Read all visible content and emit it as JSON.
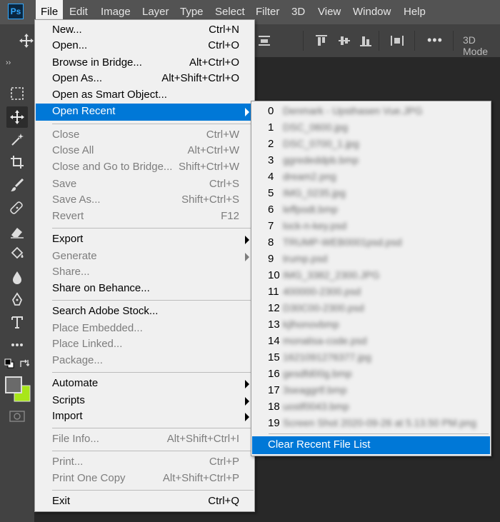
{
  "app": {
    "logo": "Ps"
  },
  "menubar": {
    "items": [
      "File",
      "Edit",
      "Image",
      "Layer",
      "Type",
      "Select",
      "Filter",
      "3D",
      "View",
      "Window",
      "Help"
    ],
    "active": "File"
  },
  "options_bar": {
    "more": "•••",
    "mode_label": "3D Mode"
  },
  "toolbar": {
    "expand": "››"
  },
  "file_menu": {
    "items": [
      {
        "label": "New...",
        "shortcut": "Ctrl+N",
        "enabled": true
      },
      {
        "label": "Open...",
        "shortcut": "Ctrl+O",
        "enabled": true
      },
      {
        "label": "Browse in Bridge...",
        "shortcut": "Alt+Ctrl+O",
        "enabled": true
      },
      {
        "label": "Open As...",
        "shortcut": "Alt+Shift+Ctrl+O",
        "enabled": true
      },
      {
        "label": "Open as Smart Object...",
        "shortcut": "",
        "enabled": true
      },
      {
        "label": "Open Recent",
        "shortcut": "",
        "enabled": true,
        "submenu": true,
        "highlighted": true
      },
      {
        "label": "Close",
        "shortcut": "Ctrl+W",
        "enabled": false
      },
      {
        "label": "Close All",
        "shortcut": "Alt+Ctrl+W",
        "enabled": false
      },
      {
        "label": "Close and Go to Bridge...",
        "shortcut": "Shift+Ctrl+W",
        "enabled": false
      },
      {
        "label": "Save",
        "shortcut": "Ctrl+S",
        "enabled": false
      },
      {
        "label": "Save As...",
        "shortcut": "Shift+Ctrl+S",
        "enabled": false
      },
      {
        "label": "Revert",
        "shortcut": "F12",
        "enabled": false
      },
      {
        "label": "Export",
        "shortcut": "",
        "enabled": true,
        "submenu": true
      },
      {
        "label": "Generate",
        "shortcut": "",
        "enabled": false,
        "submenu": true
      },
      {
        "label": "Share...",
        "shortcut": "",
        "enabled": false
      },
      {
        "label": "Share on Behance...",
        "shortcut": "",
        "enabled": true
      },
      {
        "label": "Search Adobe Stock...",
        "shortcut": "",
        "enabled": true
      },
      {
        "label": "Place Embedded...",
        "shortcut": "",
        "enabled": false
      },
      {
        "label": "Place Linked...",
        "shortcut": "",
        "enabled": false
      },
      {
        "label": "Package...",
        "shortcut": "",
        "enabled": false
      },
      {
        "label": "Automate",
        "shortcut": "",
        "enabled": true,
        "submenu": true
      },
      {
        "label": "Scripts",
        "shortcut": "",
        "enabled": true,
        "submenu": true
      },
      {
        "label": "Import",
        "shortcut": "",
        "enabled": true,
        "submenu": true
      },
      {
        "label": "File Info...",
        "shortcut": "Alt+Shift+Ctrl+I",
        "enabled": false
      },
      {
        "label": "Print...",
        "shortcut": "Ctrl+P",
        "enabled": false
      },
      {
        "label": "Print One Copy",
        "shortcut": "Alt+Shift+Ctrl+P",
        "enabled": false
      },
      {
        "label": "Exit",
        "shortcut": "Ctrl+Q",
        "enabled": true
      }
    ]
  },
  "open_recent": {
    "files": [
      {
        "num": "0",
        "name": "Denmark - Upsthasen Vue.JPG"
      },
      {
        "num": "1",
        "name": "DSC_0600.jpg"
      },
      {
        "num": "2",
        "name": "DSC_0700_1.jpg"
      },
      {
        "num": "3",
        "name": "ggrededdpb.bmp"
      },
      {
        "num": "4",
        "name": "dream2.png"
      },
      {
        "num": "5",
        "name": "IMG_0235.jpg"
      },
      {
        "num": "6",
        "name": "leffpodt.bmp"
      },
      {
        "num": "7",
        "name": "lock-n-key.psd"
      },
      {
        "num": "8",
        "name": "TRUMP-WEB0001psd.psd"
      },
      {
        "num": "9",
        "name": "trump.psd"
      },
      {
        "num": "10",
        "name": "IMG_3382_2300.JPG"
      },
      {
        "num": "11",
        "name": "400000-2300.psd"
      },
      {
        "num": "12",
        "name": "D30C00-2300.psd"
      },
      {
        "num": "13",
        "name": "kjlhonovbmp"
      },
      {
        "num": "14",
        "name": "monalisa-code.psd"
      },
      {
        "num": "15",
        "name": "1621091276377.jpg"
      },
      {
        "num": "16",
        "name": "gesdfd00g.bmp"
      },
      {
        "num": "17",
        "name": "3seaggrtf.bmp"
      },
      {
        "num": "18",
        "name": "uostf0043.bmp"
      },
      {
        "num": "19",
        "name": "Screen Shot 2020-09-26 at 5.13.50 PM.png"
      }
    ],
    "clear_label": "Clear Recent File List"
  }
}
